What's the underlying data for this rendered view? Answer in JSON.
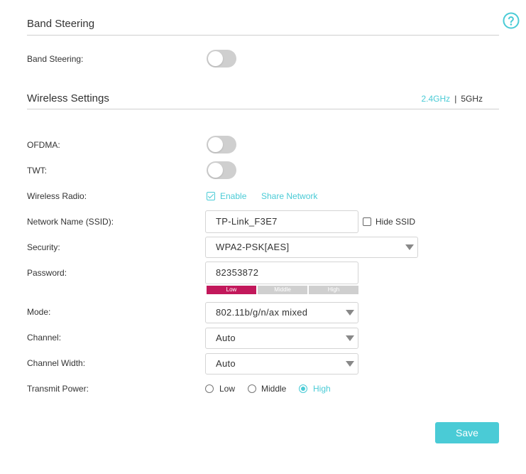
{
  "band_steering": {
    "section_title": "Band Steering",
    "label": "Band Steering:",
    "enabled": false
  },
  "wireless": {
    "section_title": "Wireless Settings",
    "bands": [
      "2.4GHz",
      "5GHz"
    ],
    "band_separator": "|",
    "active_band": "2.4GHz",
    "ofdma_label": "OFDMA:",
    "ofdma_enabled": false,
    "twt_label": "TWT:",
    "twt_enabled": false,
    "radio_label": "Wireless Radio:",
    "radio_enable_text": "Enable",
    "radio_enabled": true,
    "share_network_text": "Share Network",
    "ssid_label": "Network Name (SSID):",
    "ssid_value": "TP-Link_F3E7",
    "hide_ssid_text": "Hide SSID",
    "hide_ssid_checked": false,
    "security_label": "Security:",
    "security_value": "WPA2-PSK[AES]",
    "password_label": "Password:",
    "password_value": "82353872",
    "strength_levels": [
      "Low",
      "Middle",
      "High"
    ],
    "strength_active": "Low",
    "mode_label": "Mode:",
    "mode_value": "802.11b/g/n/ax mixed",
    "channel_label": "Channel:",
    "channel_value": "Auto",
    "channel_width_label": "Channel Width:",
    "channel_width_value": "Auto",
    "transmit_power_label": "Transmit Power:",
    "transmit_power_options": [
      "Low",
      "Middle",
      "High"
    ],
    "transmit_power_selected": "High"
  },
  "save_label": "Save",
  "colors": {
    "accent": "#4acbd6",
    "strength_low": "#c2185b",
    "toggle_off": "#cfcfcf"
  },
  "icons": {
    "help": "help-circle-icon"
  }
}
